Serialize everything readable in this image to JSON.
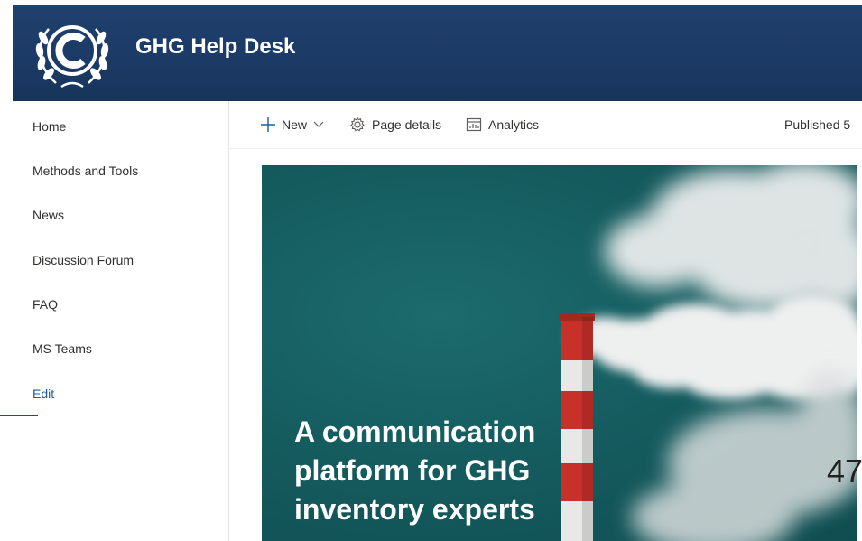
{
  "header": {
    "site_title": "GHG Help Desk",
    "logo_icon": "un-emblem-icon"
  },
  "sidebar": {
    "items": [
      {
        "label": "Home"
      },
      {
        "label": "Methods and Tools"
      },
      {
        "label": "News"
      },
      {
        "label": "Discussion Forum"
      },
      {
        "label": "FAQ"
      },
      {
        "label": "MS Teams"
      },
      {
        "label": "Edit"
      }
    ]
  },
  "commandbar": {
    "new_label": "New",
    "page_details_label": "Page details",
    "analytics_label": "Analytics",
    "published_label": "Published 5"
  },
  "hero": {
    "headline": "A communication platform for GHG inventory experts"
  },
  "overlay": {
    "page_number": "47"
  },
  "colors": {
    "header_bg": "#1b3a66",
    "edit_link": "#1b5da8",
    "hero_bg": "#155c5f"
  }
}
